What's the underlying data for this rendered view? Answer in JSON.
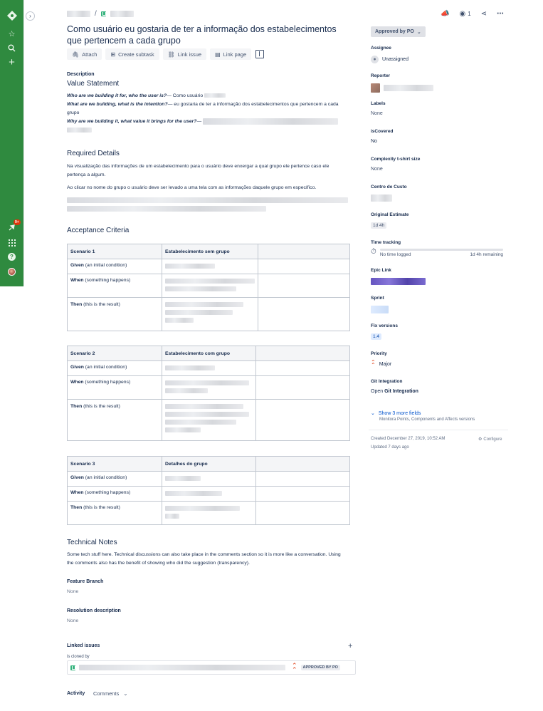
{
  "issue": {
    "title": "Como usuário eu gostaria de ter a informação dos estabelecimentos que pertencem a cada grupo"
  },
  "nav": {
    "notification_count": "9+",
    "icons": [
      "jira-logo-icon",
      "star-icon",
      "search-icon",
      "create-icon",
      "notifications-icon",
      "apps-icon",
      "help-icon",
      "avatar"
    ]
  },
  "actions": {
    "attach": "Attach",
    "create_subtask": "Create subtask",
    "link_issue": "Link issue",
    "link_page": "Link page"
  },
  "description": {
    "label": "Description",
    "value_statement_title": "Value Statement",
    "who_q": "Who are we building it for, who the user is?",
    "who_a": "— Como usuário",
    "what_q": "What are we building, what is the intention?",
    "what_a": "— eu gostaria de ter a informação dos estabelecimentos que pertencem a cada grupo",
    "why_q": "Why are we building it, what value it brings for the user?",
    "why_a": "—",
    "required_title": "Required Details",
    "req_p1": "Na visualização das informações de um estabelecimento para o usuário deve enxergar a qual grupo ele pertence caso ele pertença a algum.",
    "req_p2": "Ao clicar no nome do grupo o usuário deve ser levado a uma tela com as informações daquele grupo em específico.",
    "acceptance_title": "Acceptance Criteria",
    "tables": [
      {
        "scenario": "Scenario 1",
        "header2": "Estabelecimento sem grupo"
      },
      {
        "scenario": "Scenario 2",
        "header2": "Estabelecimento com grupo"
      },
      {
        "scenario": "Scenario 3",
        "header2": "Detalhes do grupo"
      }
    ],
    "given_b": "Given",
    "given_t": " (an initial condition)",
    "when_b": "When",
    "when_t": " (something happens)",
    "then_b": "Then",
    "then_t": " (this is the result)",
    "tech_title": "Technical Notes",
    "tech_p": "Some tech stuff here. Technical discussions can also take place in the comments section so it is more like a conversation. Using the comments also has the benefit of showing who did the suggestion (transparency).",
    "feature_branch_label": "Feature Branch",
    "feature_branch_value": "None",
    "resolution_label": "Resolution description",
    "resolution_value": "None"
  },
  "linked": {
    "title": "Linked issues",
    "relation": "is cloned by",
    "status": "APPROVED BY PO"
  },
  "activity": {
    "label": "Activity",
    "filter": "Comments"
  },
  "header": {
    "watch_count": "1"
  },
  "sidebar": {
    "status": "Approved by PO",
    "assignee_label": "Assignee",
    "assignee_value": "Unassigned",
    "reporter_label": "Reporter",
    "labels_label": "Labels",
    "labels_value": "None",
    "iscovered_label": "isCovered",
    "iscovered_value": "No",
    "complexity_label": "Complexity t-shirt size",
    "complexity_value": "None",
    "centro_label": "Centro de Custo",
    "estimate_label": "Original Estimate",
    "estimate_value": "1d 4h",
    "time_label": "Time tracking",
    "time_logged": "No time logged",
    "time_remaining": "1d 4h remaining",
    "epic_label": "Epic Link",
    "sprint_label": "Sprint",
    "fix_label": "Fix versions",
    "fix_value": "1.4",
    "priority_label": "Priority",
    "priority_value": "Major",
    "git_label": "Git Integration",
    "git_open": "Open",
    "git_link": "Git Integration",
    "more_fields": "Show 3 more fields",
    "more_fields_sub": "Monitora Points, Components and Affects versions",
    "created": "Created December 27, 2019, 10:52 AM",
    "updated": "Updated 7 days ago",
    "configure": "Configure"
  },
  "colors": {
    "nav": "#2f8a3f",
    "epic": "#6554c0",
    "priority": "#de350b"
  }
}
